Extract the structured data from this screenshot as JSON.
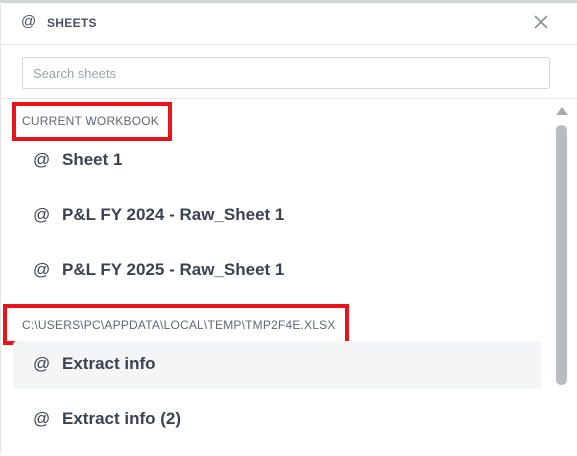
{
  "header": {
    "at_symbol": "@",
    "title": "SHEETS",
    "close_glyph": "close-icon"
  },
  "search": {
    "placeholder": "Search sheets",
    "value": ""
  },
  "sections": [
    {
      "label": "CURRENT WORKBOOK",
      "highlighted": true,
      "items": [
        {
          "at": "@",
          "label": "Sheet 1"
        },
        {
          "at": "@",
          "label": "P&L FY 2024 - Raw_Sheet 1"
        },
        {
          "at": "@",
          "label": "P&L FY 2025 - Raw_Sheet 1"
        }
      ]
    },
    {
      "label": "C:\\USERS\\PC\\APPDATA\\LOCAL\\TEMP\\TMP2F4E.XLSX",
      "highlighted": true,
      "items": [
        {
          "at": "@",
          "label": "Extract info",
          "hovered": true
        },
        {
          "at": "@",
          "label": "Extract info (2)"
        }
      ]
    }
  ],
  "colors": {
    "highlight_border": "#e8141a",
    "text_primary": "#3b4250",
    "hover_bg": "#f4f5f7"
  }
}
